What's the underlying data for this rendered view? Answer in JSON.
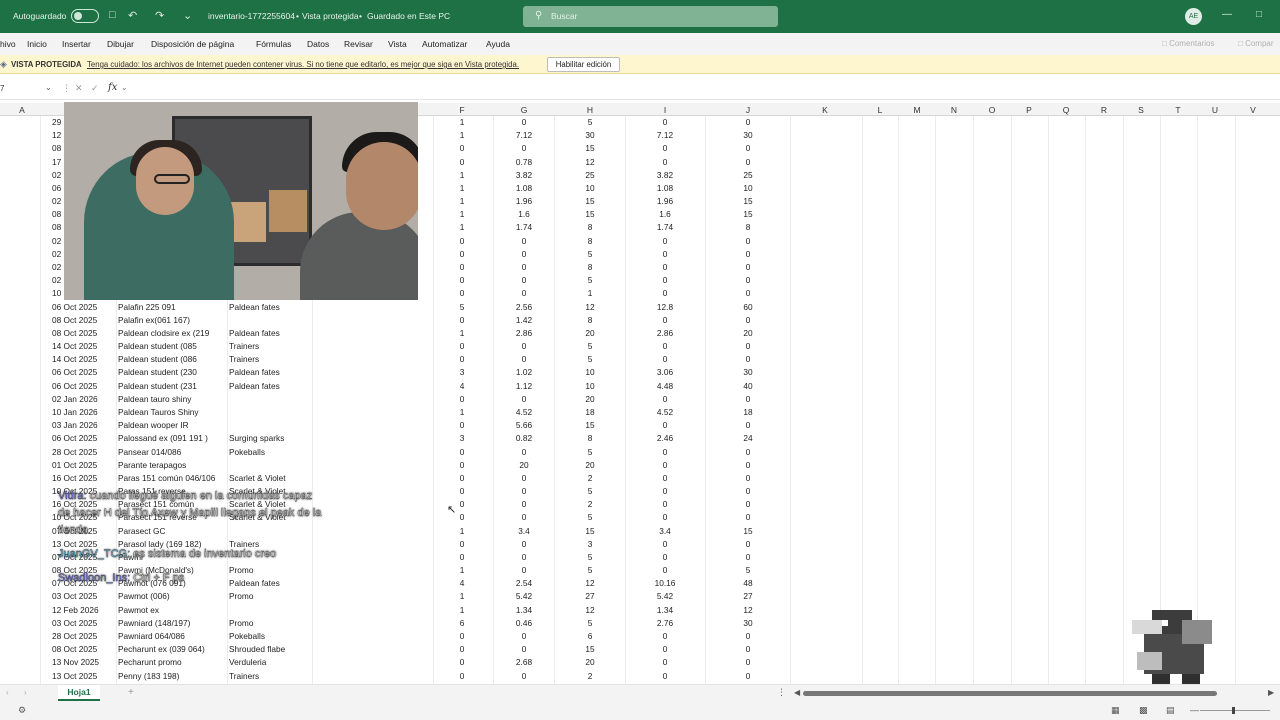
{
  "titlebar": {
    "autosave_label": "Autoguardado",
    "doc_title": "inventario-1772255604",
    "mode": "Vista protegida",
    "saved": "Guardado en Este PC",
    "title_sep1": "•",
    "title_sep2": "•",
    "search_placeholder": "Buscar",
    "avatar_initials": "AE",
    "accent": "#1e7145"
  },
  "menu": {
    "items": [
      "hivo",
      "Inicio",
      "Insertar",
      "Dibujar",
      "Disposición de página",
      "Fórmulas",
      "Datos",
      "Revisar",
      "Vista",
      "Automatizar",
      "Ayuda"
    ],
    "comments": "Comentarios",
    "share": "Compar"
  },
  "protected_view": {
    "label": "VISTA PROTEGIDA",
    "message": "Tenga cuidado: los archivos de Internet pueden contener virus. Si no tiene que editarlo, es mejor que siga en Vista protegida.",
    "button": "Habilitar edición"
  },
  "formula_bar": {
    "name_box": "7",
    "fx": "fx"
  },
  "columns": [
    "A",
    "F",
    "G",
    "H",
    "I",
    "J",
    "K",
    "L",
    "M",
    "N",
    "O",
    "P",
    "Q",
    "R",
    "S",
    "T",
    "U",
    "V"
  ],
  "rows": [
    {
      "rn": "",
      "a": "29",
      "b": "",
      "e": "",
      "f": "1",
      "g": "0",
      "h": "5",
      "i": "0",
      "j": "0"
    },
    {
      "rn": "",
      "a": "12",
      "b": "",
      "e": "",
      "f": "1",
      "g": "7.12",
      "h": "30",
      "i": "7.12",
      "j": "30"
    },
    {
      "rn": "",
      "a": "08",
      "b": "",
      "e": "",
      "f": "0",
      "g": "0",
      "h": "15",
      "i": "0",
      "j": "0"
    },
    {
      "rn": "",
      "a": "17",
      "b": "",
      "e": "",
      "f": "0",
      "g": "0.78",
      "h": "12",
      "i": "0",
      "j": "0"
    },
    {
      "rn": "",
      "a": "02",
      "b": "",
      "e": "",
      "f": "1",
      "g": "3.82",
      "h": "25",
      "i": "3.82",
      "j": "25"
    },
    {
      "rn": "",
      "a": "06",
      "b": "",
      "e": "",
      "f": "1",
      "g": "1.08",
      "h": "10",
      "i": "1.08",
      "j": "10"
    },
    {
      "rn": "",
      "a": "02",
      "b": "",
      "e": "",
      "f": "1",
      "g": "1.96",
      "h": "15",
      "i": "1.96",
      "j": "15"
    },
    {
      "rn": "",
      "a": "08",
      "b": "",
      "e": "",
      "f": "1",
      "g": "1.6",
      "h": "15",
      "i": "1.6",
      "j": "15"
    },
    {
      "rn": "",
      "a": "08",
      "b": "",
      "e": "",
      "f": "1",
      "g": "1.74",
      "h": "8",
      "i": "1.74",
      "j": "8"
    },
    {
      "rn": "",
      "a": "02",
      "b": "",
      "e": "",
      "f": "0",
      "g": "0",
      "h": "8",
      "i": "0",
      "j": "0"
    },
    {
      "rn": "",
      "a": "02",
      "b": "",
      "e": "",
      "f": "0",
      "g": "0",
      "h": "5",
      "i": "0",
      "j": "0"
    },
    {
      "rn": "",
      "a": "02",
      "b": "",
      "e": "",
      "f": "0",
      "g": "0",
      "h": "8",
      "i": "0",
      "j": "0"
    },
    {
      "rn": "",
      "a": "02",
      "b": "",
      "e": "",
      "f": "0",
      "g": "0",
      "h": "5",
      "i": "0",
      "j": "0"
    },
    {
      "rn": "",
      "a": "10",
      "b": "",
      "e": "",
      "f": "0",
      "g": "0",
      "h": "1",
      "i": "0",
      "j": "0"
    },
    {
      "rn": "",
      "a": "06 Oct 2025",
      "b": "Palafin 225 091",
      "e": "Paldean fates",
      "f": "5",
      "g": "2.56",
      "h": "12",
      "i": "12.8",
      "j": "60"
    },
    {
      "rn": "",
      "a": "08 Oct 2025",
      "b": "Palafin ex(061 167)",
      "e": "",
      "f": "0",
      "g": "1.42",
      "h": "8",
      "i": "0",
      "j": "0"
    },
    {
      "rn": "",
      "a": "08 Oct 2025",
      "b": "Paldean clodsire ex (219",
      "e": "Paldean fates",
      "f": "1",
      "g": "2.86",
      "h": "20",
      "i": "2.86",
      "j": "20"
    },
    {
      "rn": "",
      "a": "14 Oct 2025",
      "b": "Paldean student (085",
      "e": "Trainers",
      "f": "0",
      "g": "0",
      "h": "5",
      "i": "0",
      "j": "0"
    },
    {
      "rn": "",
      "a": "14 Oct 2025",
      "b": "Paldean student (086",
      "e": "Trainers",
      "f": "0",
      "g": "0",
      "h": "5",
      "i": "0",
      "j": "0"
    },
    {
      "rn": "",
      "a": "06 Oct 2025",
      "b": "Paldean student (230",
      "e": "Paldean fates",
      "f": "3",
      "g": "1.02",
      "h": "10",
      "i": "3.06",
      "j": "30"
    },
    {
      "rn": "",
      "a": "06 Oct 2025",
      "b": "Paldean student (231",
      "e": "Paldean fates",
      "f": "4",
      "g": "1.12",
      "h": "10",
      "i": "4.48",
      "j": "40"
    },
    {
      "rn": "",
      "a": "02 Jan 2026",
      "b": "Paldean tauro shiny",
      "e": "",
      "f": "0",
      "g": "0",
      "h": "20",
      "i": "0",
      "j": "0"
    },
    {
      "rn": "",
      "a": "10 Jan 2026",
      "b": "Paldean Tauros Shiny",
      "e": "",
      "f": "1",
      "g": "4.52",
      "h": "18",
      "i": "4.52",
      "j": "18"
    },
    {
      "rn": "",
      "a": "03 Jan 2026",
      "b": "Paldean wooper IR",
      "e": "",
      "f": "0",
      "g": "5.66",
      "h": "15",
      "i": "0",
      "j": "0"
    },
    {
      "rn": "",
      "a": "06 Oct 2025",
      "b": "Palossand ex (091 191 )",
      "e": "Surging sparks",
      "f": "3",
      "g": "0.82",
      "h": "8",
      "i": "2.46",
      "j": "24"
    },
    {
      "rn": "",
      "a": "28 Oct 2025",
      "b": "Pansear 014/086",
      "e": "Pokeballs",
      "f": "0",
      "g": "0",
      "h": "5",
      "i": "0",
      "j": "0"
    },
    {
      "rn": "",
      "a": "01 Oct 2025",
      "b": "Parante terapagos",
      "e": "",
      "f": "0",
      "g": "20",
      "h": "20",
      "i": "0",
      "j": "0"
    },
    {
      "rn": "",
      "a": "16 Oct 2025",
      "b": "Paras 151 común 046/106",
      "e": "Scarlet & Violet",
      "f": "0",
      "g": "0",
      "h": "2",
      "i": "0",
      "j": "0"
    },
    {
      "rn": "",
      "a": "10 Oct 2025",
      "b": "Paras 151 reverse",
      "e": "Scarlet & Violet",
      "f": "0",
      "g": "0",
      "h": "5",
      "i": "0",
      "j": "0"
    },
    {
      "rn": "",
      "a": "16 Oct 2025",
      "b": "Parasect 151 común",
      "e": "Scarlet & Violet",
      "f": "0",
      "g": "0",
      "h": "2",
      "i": "0",
      "j": "0"
    },
    {
      "rn": "",
      "a": "10 Oct 2025",
      "b": "Parasect 151 reverse",
      "e": "Scarlet & Violet",
      "f": "0",
      "g": "0",
      "h": "5",
      "i": "0",
      "j": "0"
    },
    {
      "rn": "",
      "a": "07 Oct 2025",
      "b": "Parasect GC",
      "e": "",
      "f": "1",
      "g": "3.4",
      "h": "15",
      "i": "3.4",
      "j": "15"
    },
    {
      "rn": "",
      "a": "13 Oct 2025",
      "b": "Parasol lady (169 182)",
      "e": "Trainers",
      "f": "0",
      "g": "0",
      "h": "3",
      "i": "0",
      "j": "0"
    },
    {
      "rn": "",
      "a": "07 Oct 2025",
      "b": "Pawmi",
      "e": "",
      "f": "0",
      "g": "0",
      "h": "5",
      "i": "0",
      "j": "0"
    },
    {
      "rn": "",
      "a": "08 Oct 2025",
      "b": "Pawmi (McDonald's)",
      "e": "Promo",
      "f": "1",
      "g": "0",
      "h": "5",
      "i": "0",
      "j": "5"
    },
    {
      "rn": "",
      "a": "07 Oct 2025",
      "b": "Pawmot (076 091)",
      "e": "Paldean fates",
      "f": "4",
      "g": "2.54",
      "h": "12",
      "i": "10.16",
      "j": "48"
    },
    {
      "rn": "",
      "a": "03 Oct 2025",
      "b": "Pawmot (006)",
      "e": "Promo",
      "f": "1",
      "g": "5.42",
      "h": "27",
      "i": "5.42",
      "j": "27"
    },
    {
      "rn": "",
      "a": "12 Feb 2026",
      "b": "Pawmot ex",
      "e": "",
      "f": "1",
      "g": "1.34",
      "h": "12",
      "i": "1.34",
      "j": "12"
    },
    {
      "rn": "",
      "a": "03 Oct 2025",
      "b": "Pawniard (148/197)",
      "e": "Promo",
      "f": "6",
      "g": "0.46",
      "h": "5",
      "i": "2.76",
      "j": "30"
    },
    {
      "rn": "",
      "a": "28 Oct 2025",
      "b": "Pawniard 064/086",
      "e": "Pokeballs",
      "f": "0",
      "g": "0",
      "h": "6",
      "i": "0",
      "j": "0"
    },
    {
      "rn": "",
      "a": "08 Oct 2025",
      "b": "Pecharunt ex (039 064)",
      "e": "Shrouded flabe",
      "f": "0",
      "g": "0",
      "h": "15",
      "i": "0",
      "j": "0"
    },
    {
      "rn": "",
      "a": "13 Nov 2025",
      "b": "Pecharunt promo",
      "e": "Verduleria",
      "f": "0",
      "g": "2.68",
      "h": "20",
      "i": "0",
      "j": "0"
    },
    {
      "rn": "",
      "a": "13 Oct 2025",
      "b": "Penny (183 198)",
      "e": "Trainers",
      "f": "0",
      "g": "0",
      "h": "2",
      "i": "0",
      "j": "0"
    }
  ],
  "chat": [
    {
      "user": "Vidra:",
      "text": "cuando llegué alguien en la comunidas capaz"
    },
    {
      "user": "",
      "text": "de hacer H del Tío Axew y Maplil llegans el peak de la"
    },
    {
      "user": "",
      "text": "tienda"
    },
    {
      "user": "JuanGV_TCG:",
      "text": "es sistema de inventario creo"
    },
    {
      "user": "Swadloon_Ins:",
      "text": "Ctrl + F ps"
    }
  ],
  "sheets": {
    "tab": "Hoja1",
    "add": "+"
  }
}
